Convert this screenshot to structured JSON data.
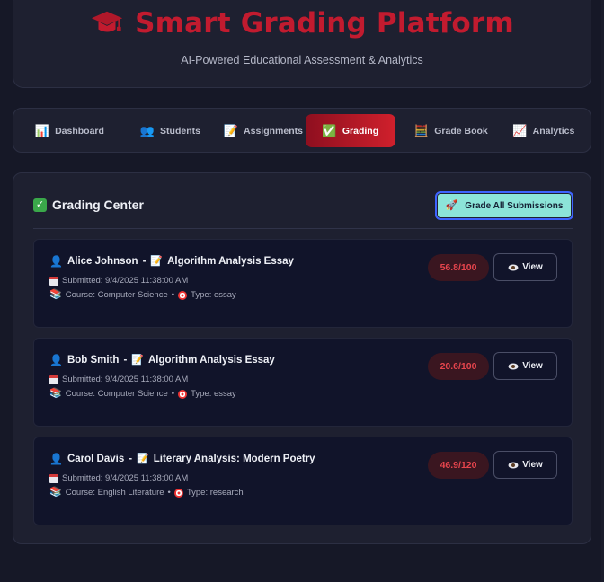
{
  "header": {
    "title": "Smart Grading Platform",
    "subtitle": "AI-Powered Educational Assessment & Analytics",
    "icon": "graduation-cap-icon",
    "title_color": "#c21b2f"
  },
  "nav": {
    "items": [
      {
        "label": "Dashboard",
        "icon": "📊"
      },
      {
        "label": "Students",
        "icon": "👥"
      },
      {
        "label": "Assignments",
        "icon": "📝"
      },
      {
        "label": "Grading",
        "icon": "✅"
      },
      {
        "label": "Grade Book",
        "icon": "🧮"
      },
      {
        "label": "Analytics",
        "icon": "📈"
      }
    ],
    "active": "Grading"
  },
  "grading": {
    "title": "Grading Center",
    "grade_all_label": "Grade All Submissions",
    "submissions": [
      {
        "student": "Alice Johnson",
        "assignment": "Algorithm Analysis Essay",
        "submitted": "Submitted: 9/4/2025 11:38:00 AM",
        "course": "Course: Computer Science",
        "type": "Type: essay",
        "score": "56.8/100",
        "view_label": "View"
      },
      {
        "student": "Bob Smith",
        "assignment": "Algorithm Analysis Essay",
        "submitted": "Submitted: 9/4/2025 11:38:00 AM",
        "course": "Course: Computer Science",
        "type": "Type: essay",
        "score": "20.6/100",
        "view_label": "View"
      },
      {
        "student": "Carol Davis",
        "assignment": "Literary Analysis: Modern Poetry",
        "submitted": "Submitted: 9/4/2025 11:38:00 AM",
        "course": "Course: English Literature",
        "type": "Type: research",
        "score": "46.9/120",
        "view_label": "View"
      }
    ]
  },
  "colors": {
    "accent": "#c21b2f",
    "score_text": "#e6454d",
    "grade_all_bg": "#8ce4d9"
  }
}
